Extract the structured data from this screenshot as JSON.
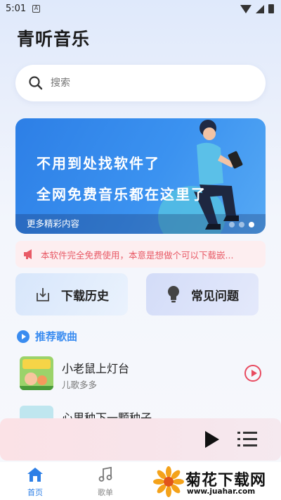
{
  "status_bar": {
    "time": "5:01",
    "notif_badge": "A"
  },
  "app": {
    "title": "青听音乐"
  },
  "search": {
    "placeholder": "搜索"
  },
  "banner": {
    "line1": "不用到处找软件了",
    "line2": "全网免费音乐都在这里了",
    "caption": "更多精彩内容",
    "active_slide": 3,
    "slide_count": 3
  },
  "notice": {
    "text": "本软件完全免费使用，本意是想做个可以下载嵌..."
  },
  "quick_actions": [
    {
      "label": "下载历史",
      "icon": "download-box-icon"
    },
    {
      "label": "常见问题",
      "icon": "lightbulb-icon"
    }
  ],
  "recommended": {
    "title": "推荐歌曲",
    "songs": [
      {
        "title": "小老鼠上灯台",
        "artist": "儿歌多多"
      },
      {
        "title": "心里种下一颗种子",
        "artist": ""
      }
    ]
  },
  "bottom_nav": [
    {
      "label": "首页",
      "active": true
    },
    {
      "label": "歌单",
      "active": false
    }
  ],
  "watermark": {
    "title": "菊花下载网",
    "url": "www.juahar.com"
  },
  "colors": {
    "accent": "#2d7fe6",
    "notice": "#e85a66",
    "play_red": "#e84a5f"
  }
}
